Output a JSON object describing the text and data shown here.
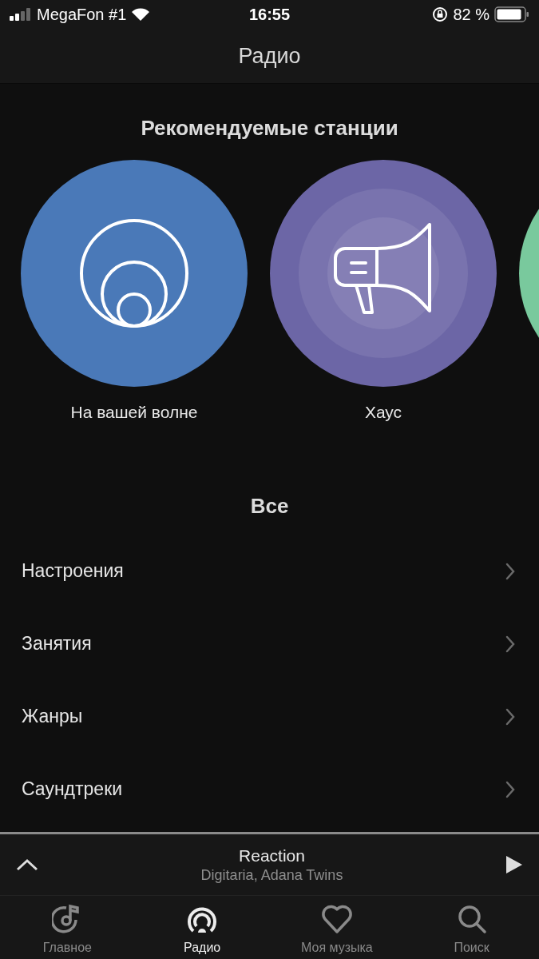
{
  "status_bar": {
    "carrier": "MegaFon #1",
    "time": "16:55",
    "battery": "82 %"
  },
  "nav_bar": {
    "title": "Радио"
  },
  "featured": {
    "title": "Рекомендуемые станции",
    "stations": [
      {
        "kind": "waves",
        "color": "#4a79b8",
        "label": "На вашей волне"
      },
      {
        "kind": "megaphone",
        "color": "#6c66a6",
        "label": "Хаус"
      },
      {
        "kind": "plain",
        "color": "#79c99d"
      }
    ]
  },
  "all": {
    "title": "Все",
    "items": [
      "Настроения",
      "Занятия",
      "Жанры",
      "Саундтреки"
    ]
  },
  "mini_player": {
    "title": "Reaction",
    "artist": "Digitaria, Adana Twins"
  },
  "tabs": [
    {
      "kind": "home",
      "label": "Главное",
      "selected": false
    },
    {
      "kind": "radio",
      "label": "Радио",
      "selected": true
    },
    {
      "kind": "heart",
      "label": "Моя музыка",
      "selected": false
    },
    {
      "kind": "search",
      "label": "Поиск",
      "selected": false
    }
  ]
}
